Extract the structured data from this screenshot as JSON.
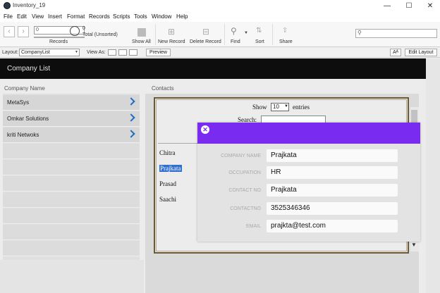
{
  "window": {
    "title": "Inventory_19",
    "minimize": "—",
    "maximize": "☐",
    "close": "✕"
  },
  "menu": [
    "File",
    "Edit",
    "View",
    "Insert",
    "Format",
    "Records",
    "Scripts",
    "Tools",
    "Window",
    "Help"
  ],
  "toolbar": {
    "record_value": "0",
    "records_label": "Records",
    "total_count": "0",
    "total_label": "Total (Unsorted)",
    "show_all": "Show All",
    "new_record": "New Record",
    "delete_record": "Delete Record",
    "find": "Find",
    "sort": "Sort",
    "share": "Share"
  },
  "layoutbar": {
    "layout_label": "Layout:",
    "layout_value": "CompanyList",
    "view_as_label": "View As:",
    "preview": "Preview",
    "aa": "Aᴬ",
    "edit_layout": "Edit Layout"
  },
  "header": {
    "title": "Company List"
  },
  "companies": {
    "label": "Company Name",
    "items": [
      "MetaSys",
      "Omkar Solutions",
      "kriti Netwoks"
    ]
  },
  "contacts": {
    "label": "Contacts",
    "show": "Show",
    "entries_value": "10",
    "entries": "entries",
    "search": "Search:",
    "names": [
      "Chitra",
      "Prajkata",
      "Prasad",
      "Saachi"
    ]
  },
  "modal": {
    "close": "✕",
    "fields": [
      {
        "label": "COMPANY NAME",
        "value": "Prajkata"
      },
      {
        "label": "OCCUPATION",
        "value": "HR"
      },
      {
        "label": "CONTACT NO",
        "value": "Prajkata"
      },
      {
        "label": "CONTACTNO",
        "value": "3525346346"
      },
      {
        "label": "EMAIL",
        "value": "prajkta@test.com"
      }
    ]
  },
  "colors": {
    "modal_header": "#7a2bf0",
    "header_bg": "#0d0d0d",
    "chevron": "#1a6fc4"
  }
}
